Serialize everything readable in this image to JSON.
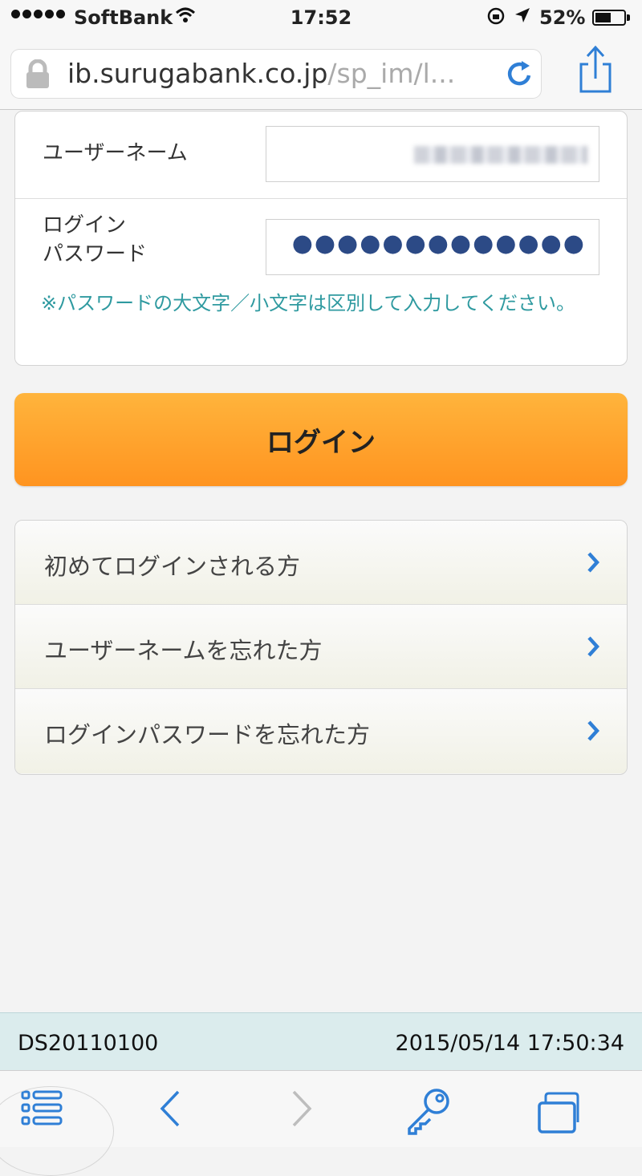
{
  "status_bar": {
    "carrier": "SoftBank",
    "time": "17:52",
    "battery_percent": "52%",
    "battery_level": 0.52
  },
  "browser": {
    "url_host": "ib.surugabank.co.jp",
    "url_path": "/sp_im/l...",
    "icons": [
      "padlock-icon",
      "reload-icon",
      "share-icon"
    ]
  },
  "login_form": {
    "username_label": "ユーザーネーム",
    "password_label_line1": "ログイン",
    "password_label_line2": "パスワード",
    "password_masked": "●●●●●●●●●●●●●",
    "password_note": "※パスワードの大文字／小文字は区別して入力してください。"
  },
  "login_button_label": "ログイン",
  "help_links": [
    {
      "label": "初めてログインされる方"
    },
    {
      "label": "ユーザーネームを忘れた方"
    },
    {
      "label": "ログインパスワードを忘れた方"
    }
  ],
  "footer": {
    "code": "DS20110100",
    "timestamp": "2015/05/14 17:50:34"
  },
  "toolbar": {
    "icons": [
      "bookmarks-icon",
      "back-icon",
      "forward-icon",
      "key-icon",
      "tabs-icon"
    ]
  },
  "colors": {
    "accent_blue": "#2f7fd6",
    "login_button": "#ff9f2a",
    "note_teal": "#2f9aa0",
    "footer_bg": "#dbeced"
  }
}
